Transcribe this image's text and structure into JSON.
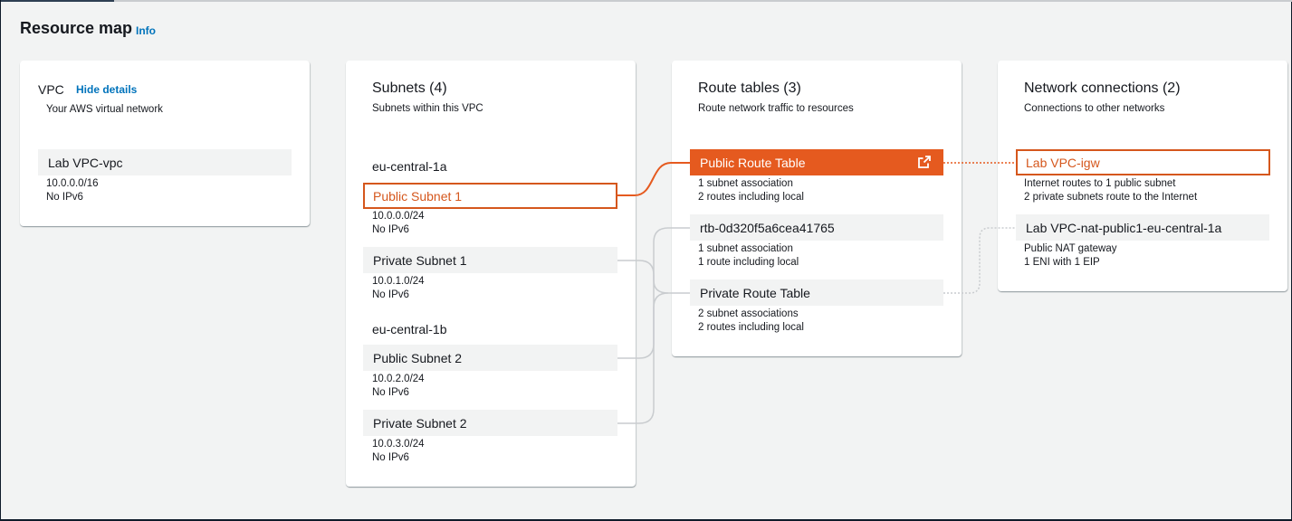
{
  "header": {
    "title": "Resource map",
    "info_label": "Info"
  },
  "vpc": {
    "title": "VPC",
    "hide_details_label": "Hide details",
    "subtitle": "Your AWS virtual network",
    "node": {
      "name": "Lab VPC-vpc",
      "cidr": "10.0.0.0/16",
      "ipv6": "No IPv6"
    }
  },
  "subnets": {
    "title": "Subnets (4)",
    "subtitle": "Subnets within this VPC",
    "zones": [
      {
        "name": "eu-central-1a"
      },
      {
        "name": "eu-central-1b"
      }
    ],
    "items": [
      {
        "name": "Public Subnet 1",
        "cidr": "10.0.0.0/24",
        "ipv6": "No IPv6"
      },
      {
        "name": "Private Subnet 1",
        "cidr": "10.0.1.0/24",
        "ipv6": "No IPv6"
      },
      {
        "name": "Public Subnet 2",
        "cidr": "10.0.2.0/24",
        "ipv6": "No IPv6"
      },
      {
        "name": "Private Subnet 2",
        "cidr": "10.0.3.0/24",
        "ipv6": "No IPv6"
      }
    ]
  },
  "route_tables": {
    "title": "Route tables (3)",
    "subtitle": "Route network traffic to resources",
    "items": [
      {
        "name": "Public Route Table",
        "line1": "1 subnet association",
        "line2": "2 routes including local",
        "icon": "external-link-icon"
      },
      {
        "name": "rtb-0d320f5a6cea41765",
        "line1": "1 subnet association",
        "line2": "1 route including local"
      },
      {
        "name": "Private Route Table",
        "line1": "2 subnet associations",
        "line2": "2 routes including local"
      }
    ]
  },
  "network_connections": {
    "title": "Network connections (2)",
    "subtitle": "Connections to other networks",
    "items": [
      {
        "name": "Lab VPC-igw",
        "line1": "Internet routes to 1 public subnet",
        "line2": "2 private subnets route to the Internet"
      },
      {
        "name": "Lab VPC-nat-public1-eu-central-1a",
        "line1": "Public NAT gateway",
        "line2": "1 ENI with 1 EIP"
      }
    ]
  },
  "colors": {
    "accent": "#e55a1f",
    "link": "#0073bb",
    "connector": "#c9cccf"
  }
}
